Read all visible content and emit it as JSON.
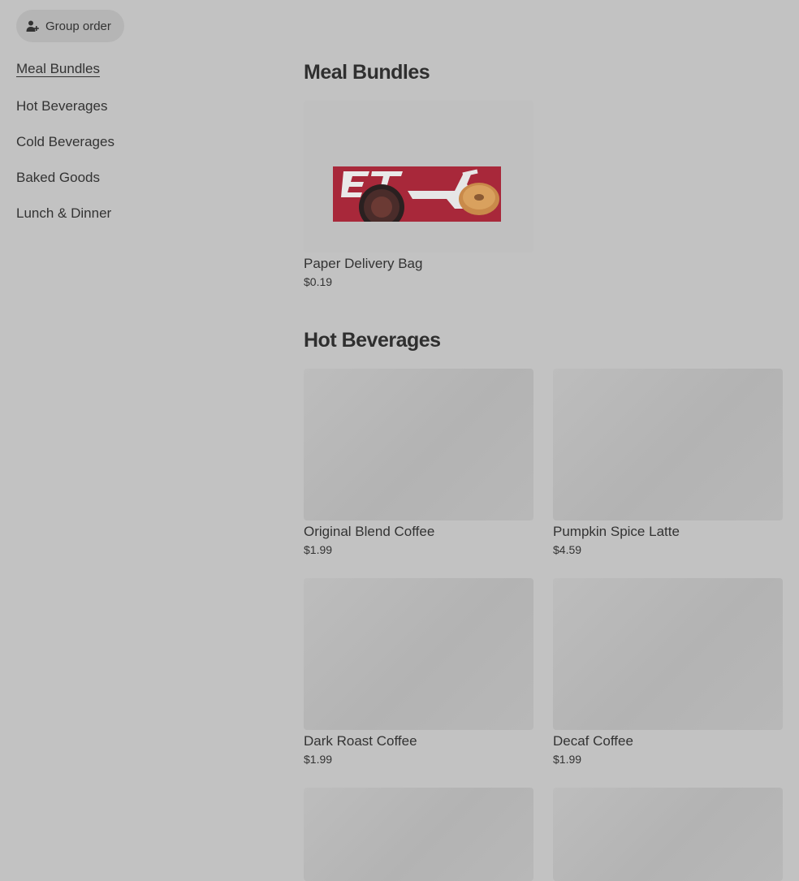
{
  "header": {
    "group_order_label": "Group order"
  },
  "sidebar": {
    "items": [
      {
        "label": "Meal Bundles"
      },
      {
        "label": "Hot Beverages"
      },
      {
        "label": "Cold Beverages"
      },
      {
        "label": "Baked Goods"
      },
      {
        "label": "Lunch & Dinner"
      }
    ]
  },
  "sections": {
    "meal_bundles": {
      "title": "Meal Bundles",
      "items": [
        {
          "name": "Paper Delivery Bag",
          "price": "$0.19"
        }
      ]
    },
    "hot_beverages": {
      "title": "Hot Beverages",
      "items": [
        {
          "name": "Original Blend Coffee",
          "price": "$1.99"
        },
        {
          "name": "Pumpkin Spice Latte",
          "price": "$4.59"
        },
        {
          "name": "Dark Roast Coffee",
          "price": "$1.99"
        },
        {
          "name": "Decaf Coffee",
          "price": "$1.99"
        }
      ]
    }
  },
  "icons": {
    "group_order": "person-add-icon",
    "bag_logo": "delivery-bag-logo"
  },
  "colors": {
    "background": "#c2c2c2",
    "bag_red": "#a8283a"
  }
}
